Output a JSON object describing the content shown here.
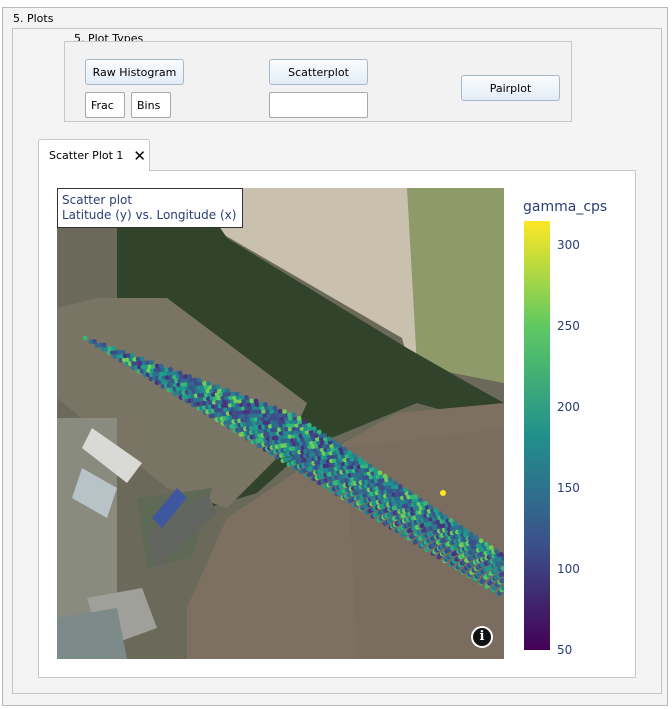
{
  "section": {
    "title": "5. Plots"
  },
  "plot_types": {
    "title": "5. Plot Types",
    "raw_histogram_label": "Raw Histogram",
    "frac_placeholder": "Frac",
    "bins_placeholder": "Bins",
    "scatterplot_label": "Scatterplot",
    "scatter_field_value": "",
    "pairplot_label": "Pairplot"
  },
  "tab": {
    "label": "Scatter Plot 1"
  },
  "plot": {
    "title_line1": "Scatter plot",
    "title_line2": "Latitude (y) vs. Longitude (x)",
    "colorbar": {
      "title": "gamma_cps",
      "ticks": [
        "300",
        "250",
        "200",
        "150",
        "100",
        "50"
      ],
      "min": 50,
      "max": 315,
      "colorscale": [
        "#440154",
        "#3b528b",
        "#21908c",
        "#5dc863",
        "#fde725"
      ]
    },
    "info_icon": "info-icon"
  },
  "colors": {
    "accent_text": "#2b3e75",
    "button_border": "#a9b7c7"
  }
}
